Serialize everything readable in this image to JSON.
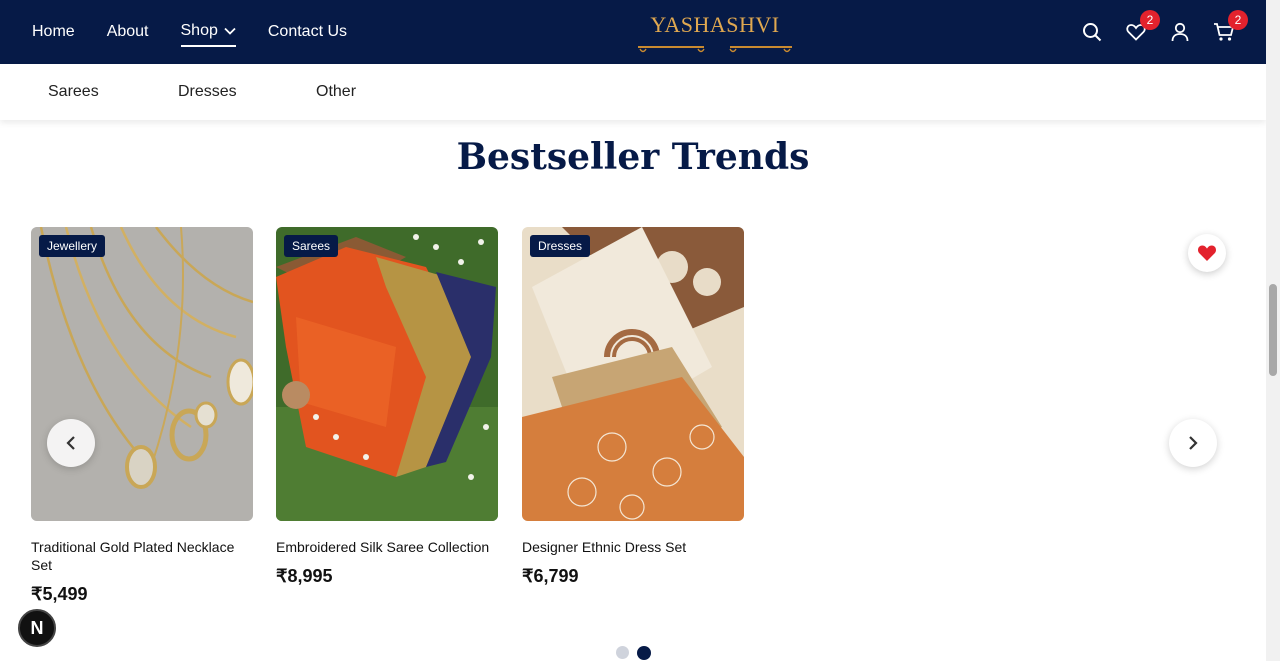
{
  "nav": {
    "items": [
      {
        "label": "Home"
      },
      {
        "label": "About"
      },
      {
        "label": "Shop"
      },
      {
        "label": "Contact Us"
      }
    ]
  },
  "brand": {
    "logo_text": "YASHASHVI",
    "logo_color": "#e0a850"
  },
  "header_icons": {
    "wishlist_count": "2",
    "cart_count": "2",
    "icons": [
      "search-icon",
      "heart-icon",
      "user-icon",
      "cart-icon"
    ]
  },
  "subnav": {
    "items": [
      {
        "label": "Sarees"
      },
      {
        "label": "Dresses"
      },
      {
        "label": "Other"
      }
    ]
  },
  "section": {
    "title": "Bestseller Trends"
  },
  "products": [
    {
      "tag": "Jewellery",
      "name": "Traditional Gold Plated Necklace Set",
      "price": "₹5,499"
    },
    {
      "tag": "Sarees",
      "name": "Embroidered Silk Saree Collection",
      "price": "₹8,995"
    },
    {
      "tag": "Dresses",
      "name": "Designer Ethnic Dress Set",
      "price": "₹6,799"
    }
  ],
  "carousel": {
    "page_count": 2,
    "active_page": 2
  },
  "floating": {
    "n_badge": "N"
  },
  "colors": {
    "navy": "#061a47",
    "badge_red": "#e3222d",
    "accent_gold": "#c98a30"
  }
}
